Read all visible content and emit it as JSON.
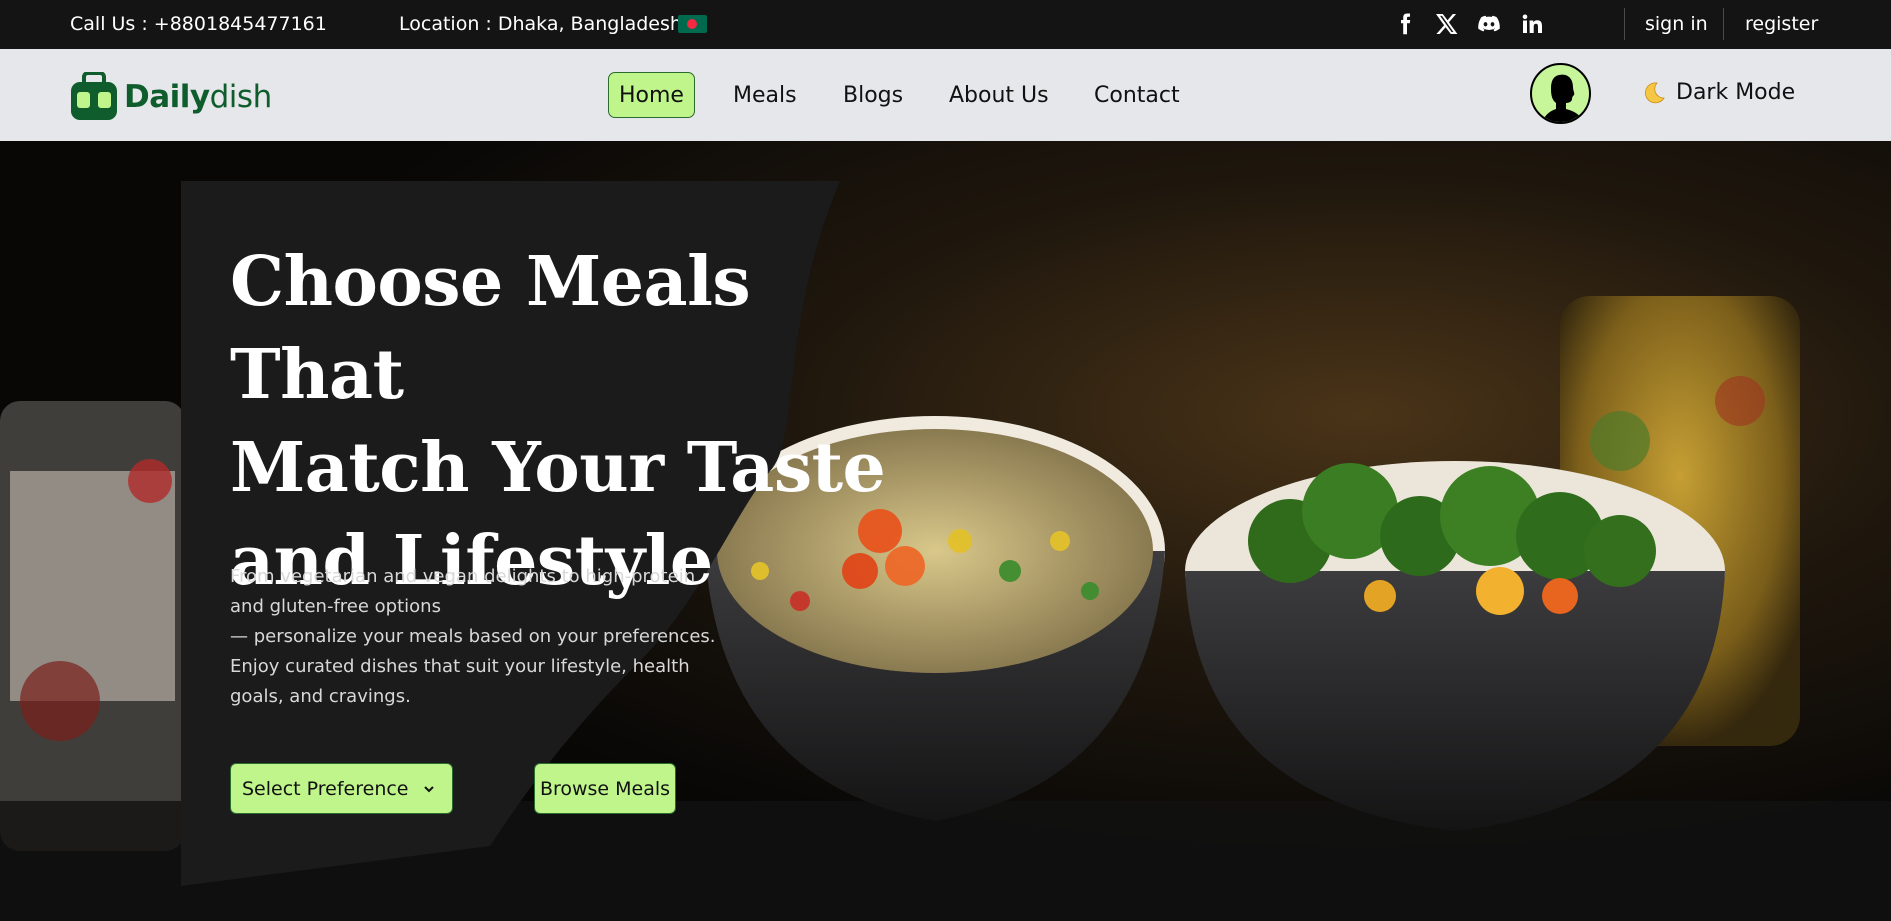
{
  "topbar": {
    "call": "Call Us : +8801845477161",
    "location": "Location : Dhaka, Bangladesh",
    "flag_icon": "bangladesh-flag-icon",
    "social_icons": [
      "facebook-icon",
      "x-icon",
      "discord-icon",
      "linkedin-icon"
    ],
    "sign_in": "sign in",
    "register": "register"
  },
  "navbar": {
    "logo_bold": "Daily",
    "logo_light": "dish",
    "items": [
      {
        "label": "Home",
        "active": true
      },
      {
        "label": "Meals",
        "active": false
      },
      {
        "label": "Blogs",
        "active": false
      },
      {
        "label": "About Us",
        "active": false
      },
      {
        "label": "Contact",
        "active": false
      }
    ],
    "dark_mode": "Dark Mode"
  },
  "hero": {
    "title_lines": [
      "Choose Meals That",
      "Match Your Taste",
      "and Lifestyle"
    ],
    "description_lines": [
      "From vegetarian and vegan delights to high-protein",
      "and gluten-free options",
      "— personalize your meals based on your preferences.",
      "Enjoy curated dishes that suit your lifestyle, health",
      "goals, and cravings."
    ],
    "select_label": "Select Preference",
    "browse_label": "Browse Meals"
  },
  "colors": {
    "accent": "#bff58a",
    "accent_border": "#2b6b2e",
    "brand_green": "#0f5c2c",
    "topbar_bg": "#141414",
    "navbar_bg": "#e6e7eb",
    "panel_bg": "#1b1b1c"
  }
}
